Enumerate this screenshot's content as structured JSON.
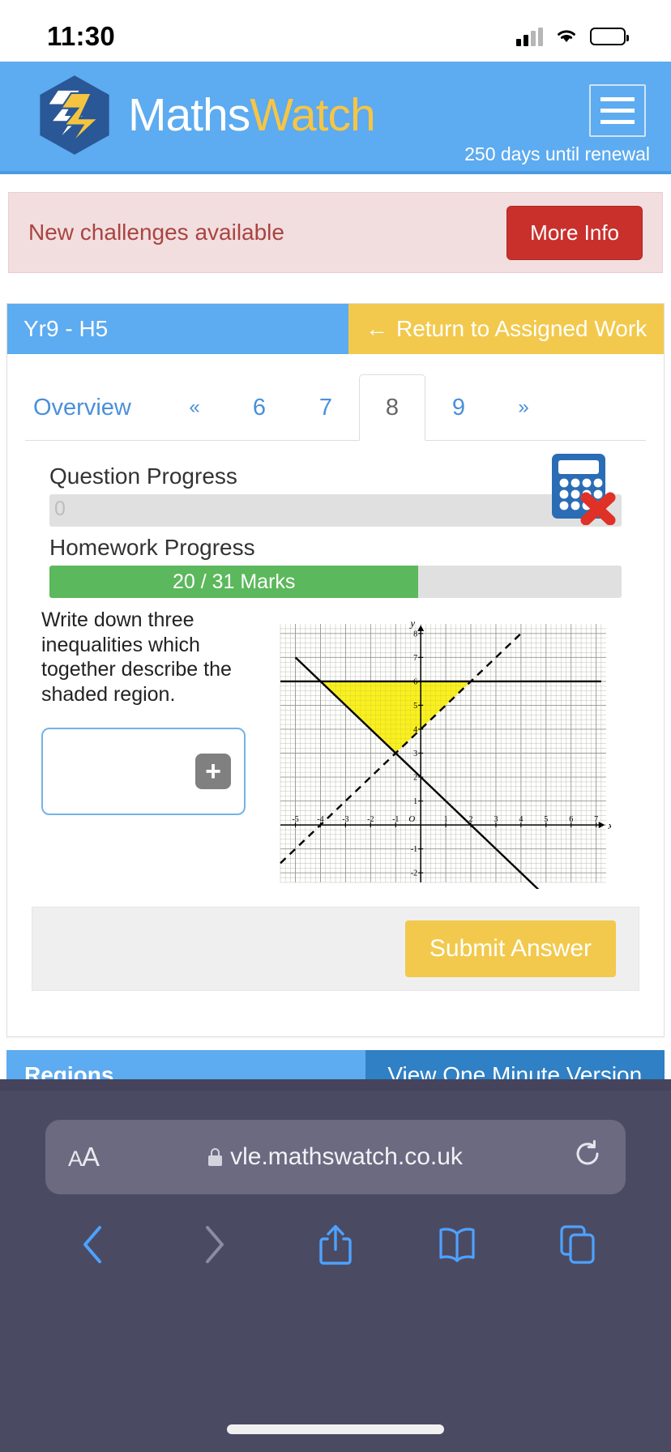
{
  "status_bar": {
    "time": "11:30",
    "signal_icon": "cellular-signal-icon",
    "wifi_icon": "wifi-icon",
    "battery_icon": "battery-icon"
  },
  "header": {
    "logo_icon": "mathswatch-logo-icon",
    "title_first": "Maths",
    "title_second": "Watch",
    "menu_icon": "hamburger-menu-icon",
    "renewal_text": "250 days until renewal"
  },
  "alert": {
    "message": "New challenges available",
    "button_label": "More Info"
  },
  "panel": {
    "assignment_title": "Yr9 - H5",
    "return_label": "Return to Assigned Work",
    "return_arrow": "←"
  },
  "tabs": {
    "overview_label": "Overview",
    "prev_label": "«",
    "next_label": "»",
    "pages": [
      "6",
      "7",
      "8",
      "9"
    ],
    "active_page": "8"
  },
  "progress": {
    "question_label": "Question Progress",
    "question_value": "0",
    "question_percent": 0,
    "homework_label": "Homework Progress",
    "homework_value": "20 / 31 Marks",
    "homework_percent": 64.5,
    "calculator_icon": "calculator-not-allowed-icon"
  },
  "question": {
    "text": "Write down three inequalities which together describe the shaded region.",
    "answer_placeholder": "",
    "answer_value": "",
    "add_icon": "plus-icon"
  },
  "submit": {
    "label": "Submit Answer"
  },
  "regions": {
    "title": "Regions",
    "video_label": "View One Minute Version"
  },
  "safari": {
    "text_size_label": "A",
    "text_size_label_big": "A",
    "lock_icon": "lock-icon",
    "url": "vle.mathswatch.co.uk",
    "reload_icon": "reload-icon",
    "back_icon": "back-chevron-icon",
    "forward_icon": "forward-chevron-icon",
    "share_icon": "share-icon",
    "bookmarks_icon": "bookmarks-book-icon",
    "tabs_icon": "tabs-icon"
  },
  "chart_data": {
    "type": "line",
    "title": "",
    "xlabel": "x",
    "ylabel": "y",
    "xlim": [
      -5.6,
      7.4
    ],
    "ylim": [
      -2.4,
      8.4
    ],
    "grid": true,
    "minor_grid": true,
    "x_ticks": [
      -5,
      -4,
      -3,
      -2,
      -1,
      1,
      2,
      3,
      4,
      5,
      6,
      7
    ],
    "y_ticks": [
      -2,
      -1,
      1,
      2,
      3,
      4,
      5,
      6,
      7,
      8
    ],
    "origin_label": "O",
    "series": [
      {
        "name": "y = 6",
        "style": "solid",
        "equation_text": "y = 6",
        "points": [
          [
            -5.6,
            6
          ],
          [
            7.2,
            6
          ]
        ]
      },
      {
        "name": "y = -x + 2",
        "style": "solid",
        "equation_text": "x + y = 2",
        "points": [
          [
            -5.0,
            7.0
          ],
          [
            5.4,
            -3.4
          ]
        ]
      },
      {
        "name": "y = x + 4",
        "style": "dashed",
        "equation_text": "y = x + 4",
        "points": [
          [
            -5.6,
            -1.6
          ],
          [
            4.0,
            8.0
          ]
        ]
      }
    ],
    "shaded_region": {
      "fill_color": "#faf01e",
      "vertices": [
        [
          -4,
          6
        ],
        [
          2,
          6
        ],
        [
          -1,
          3
        ]
      ],
      "description": "Triangular region bounded by y = 6 above, x + y = 2 below-left, and y = x + 4 below-right"
    }
  }
}
